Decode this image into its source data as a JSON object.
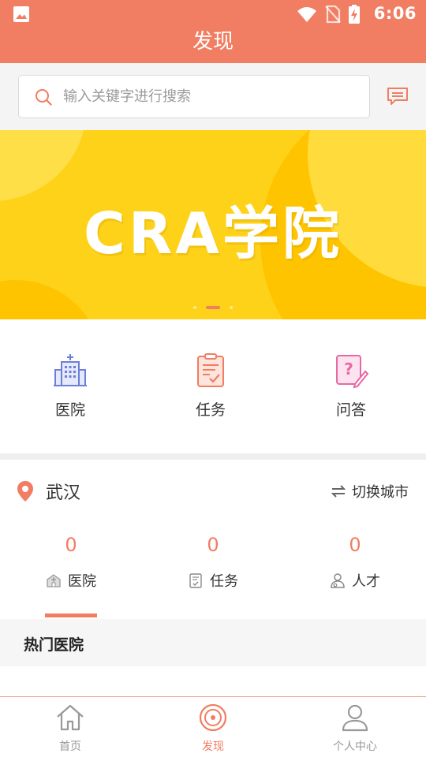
{
  "status_bar": {
    "time": "6:06",
    "icons": [
      "image-icon",
      "wifi-icon",
      "no-sim-icon",
      "battery-charging-icon"
    ]
  },
  "header": {
    "title": "发现"
  },
  "search": {
    "placeholder": "输入关键字进行搜索",
    "value": "",
    "message_icon": "message-icon"
  },
  "banner": {
    "title": "CRA学院",
    "slide_count": 3,
    "active_slide": 2
  },
  "quick_actions": [
    {
      "label": "医院",
      "icon": "hospital-icon",
      "color": "#6b7fd6"
    },
    {
      "label": "任务",
      "icon": "task-icon",
      "color": "#f17d62"
    },
    {
      "label": "问答",
      "icon": "qa-icon",
      "color": "#e868a2"
    }
  ],
  "location": {
    "city": "武汉",
    "switch_label": "切换城市"
  },
  "stats": [
    {
      "count": "0",
      "label": "医院",
      "icon": "hospital-icon"
    },
    {
      "count": "0",
      "label": "任务",
      "icon": "task-icon"
    },
    {
      "count": "0",
      "label": "人才",
      "icon": "person-icon"
    }
  ],
  "hot_section": {
    "title": "热门医院"
  },
  "tabbar": {
    "items": [
      {
        "label": "首页",
        "icon": "home-icon",
        "active": false
      },
      {
        "label": "发现",
        "icon": "discover-icon",
        "active": true
      },
      {
        "label": "个人中心",
        "icon": "profile-icon",
        "active": false
      }
    ]
  },
  "colors": {
    "accent": "#f17d62",
    "banner_bg": "#ffd21a",
    "hospital": "#6b7fd6",
    "qa": "#e868a2"
  }
}
